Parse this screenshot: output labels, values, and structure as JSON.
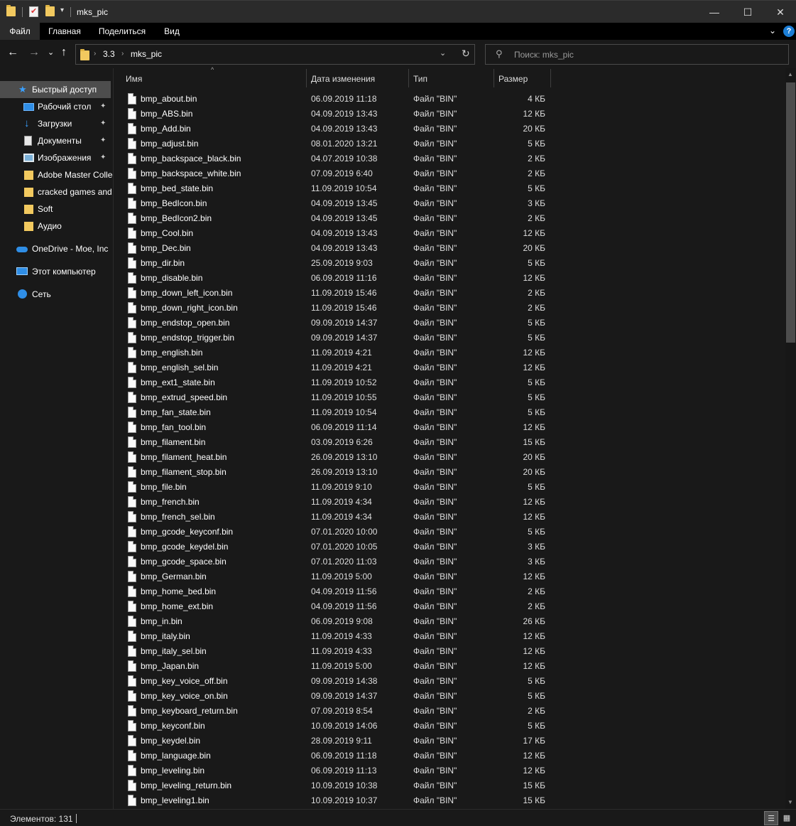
{
  "window": {
    "title": "mks_pic",
    "minimize_glyph": "—",
    "maximize_glyph": "☐",
    "close_glyph": "✕"
  },
  "ribbon": {
    "tabs": [
      "Файл",
      "Главная",
      "Поделиться",
      "Вид"
    ],
    "active_tab": "Файл",
    "collapse_glyph": "⌄",
    "help_glyph": "?"
  },
  "address": {
    "crumbs": [
      "3.3",
      "mks_pic"
    ],
    "back_glyph": "←",
    "forward_glyph": "→",
    "recent_glyph": "⌄",
    "up_glyph": "↑",
    "dropdown_glyph": "⌄",
    "refresh_glyph": "↻"
  },
  "search": {
    "placeholder": "Поиск: mks_pic",
    "icon": "search-icon"
  },
  "nav": {
    "quick_access": "Быстрый доступ",
    "items": [
      {
        "label": "Рабочий стол",
        "icon": "desktop-icon",
        "pinned": true
      },
      {
        "label": "Загрузки",
        "icon": "downloads-icon",
        "pinned": true
      },
      {
        "label": "Документы",
        "icon": "documents-icon",
        "pinned": true
      },
      {
        "label": "Изображения",
        "icon": "pictures-icon",
        "pinned": true
      },
      {
        "label": "Adobe Master Collection",
        "icon": "folder-icon",
        "pinned": false
      },
      {
        "label": "cracked games and",
        "icon": "folder-icon",
        "pinned": false
      },
      {
        "label": "Soft",
        "icon": "folder-icon",
        "pinned": false
      },
      {
        "label": "Аудио",
        "icon": "folder-icon",
        "pinned": false
      }
    ],
    "onedrive": "OneDrive - Moe, Inc",
    "this_pc": "Этот компьютер",
    "network": "Сеть",
    "pin_glyph": "📌"
  },
  "columns": {
    "name": "Имя",
    "date": "Дата изменения",
    "type": "Тип",
    "size": "Размер",
    "sort_glyph": "^"
  },
  "files": [
    {
      "name": "bmp_about.bin",
      "date": "06.09.2019 11:18",
      "type": "Файл \"BIN\"",
      "size": "4 КБ"
    },
    {
      "name": "bmp_ABS.bin",
      "date": "04.09.2019 13:43",
      "type": "Файл \"BIN\"",
      "size": "12 КБ"
    },
    {
      "name": "bmp_Add.bin",
      "date": "04.09.2019 13:43",
      "type": "Файл \"BIN\"",
      "size": "20 КБ"
    },
    {
      "name": "bmp_adjust.bin",
      "date": "08.01.2020 13:21",
      "type": "Файл \"BIN\"",
      "size": "5 КБ"
    },
    {
      "name": "bmp_backspace_black.bin",
      "date": "04.07.2019 10:38",
      "type": "Файл \"BIN\"",
      "size": "2 КБ"
    },
    {
      "name": "bmp_backspace_white.bin",
      "date": "07.09.2019 6:40",
      "type": "Файл \"BIN\"",
      "size": "2 КБ"
    },
    {
      "name": "bmp_bed_state.bin",
      "date": "11.09.2019 10:54",
      "type": "Файл \"BIN\"",
      "size": "5 КБ"
    },
    {
      "name": "bmp_BedIcon.bin",
      "date": "04.09.2019 13:45",
      "type": "Файл \"BIN\"",
      "size": "3 КБ"
    },
    {
      "name": "bmp_BedIcon2.bin",
      "date": "04.09.2019 13:45",
      "type": "Файл \"BIN\"",
      "size": "2 КБ"
    },
    {
      "name": "bmp_Cool.bin",
      "date": "04.09.2019 13:43",
      "type": "Файл \"BIN\"",
      "size": "12 КБ"
    },
    {
      "name": "bmp_Dec.bin",
      "date": "04.09.2019 13:43",
      "type": "Файл \"BIN\"",
      "size": "20 КБ"
    },
    {
      "name": "bmp_dir.bin",
      "date": "25.09.2019 9:03",
      "type": "Файл \"BIN\"",
      "size": "5 КБ"
    },
    {
      "name": "bmp_disable.bin",
      "date": "06.09.2019 11:16",
      "type": "Файл \"BIN\"",
      "size": "12 КБ"
    },
    {
      "name": "bmp_down_left_icon.bin",
      "date": "11.09.2019 15:46",
      "type": "Файл \"BIN\"",
      "size": "2 КБ"
    },
    {
      "name": "bmp_down_right_icon.bin",
      "date": "11.09.2019 15:46",
      "type": "Файл \"BIN\"",
      "size": "2 КБ"
    },
    {
      "name": "bmp_endstop_open.bin",
      "date": "09.09.2019 14:37",
      "type": "Файл \"BIN\"",
      "size": "5 КБ"
    },
    {
      "name": "bmp_endstop_trigger.bin",
      "date": "09.09.2019 14:37",
      "type": "Файл \"BIN\"",
      "size": "5 КБ"
    },
    {
      "name": "bmp_english.bin",
      "date": "11.09.2019 4:21",
      "type": "Файл \"BIN\"",
      "size": "12 КБ"
    },
    {
      "name": "bmp_english_sel.bin",
      "date": "11.09.2019 4:21",
      "type": "Файл \"BIN\"",
      "size": "12 КБ"
    },
    {
      "name": "bmp_ext1_state.bin",
      "date": "11.09.2019 10:52",
      "type": "Файл \"BIN\"",
      "size": "5 КБ"
    },
    {
      "name": "bmp_extrud_speed.bin",
      "date": "11.09.2019 10:55",
      "type": "Файл \"BIN\"",
      "size": "5 КБ"
    },
    {
      "name": "bmp_fan_state.bin",
      "date": "11.09.2019 10:54",
      "type": "Файл \"BIN\"",
      "size": "5 КБ"
    },
    {
      "name": "bmp_fan_tool.bin",
      "date": "06.09.2019 11:14",
      "type": "Файл \"BIN\"",
      "size": "12 КБ"
    },
    {
      "name": "bmp_filament.bin",
      "date": "03.09.2019 6:26",
      "type": "Файл \"BIN\"",
      "size": "15 КБ"
    },
    {
      "name": "bmp_filament_heat.bin",
      "date": "26.09.2019 13:10",
      "type": "Файл \"BIN\"",
      "size": "20 КБ"
    },
    {
      "name": "bmp_filament_stop.bin",
      "date": "26.09.2019 13:10",
      "type": "Файл \"BIN\"",
      "size": "20 КБ"
    },
    {
      "name": "bmp_file.bin",
      "date": "11.09.2019 9:10",
      "type": "Файл \"BIN\"",
      "size": "5 КБ"
    },
    {
      "name": "bmp_french.bin",
      "date": "11.09.2019 4:34",
      "type": "Файл \"BIN\"",
      "size": "12 КБ"
    },
    {
      "name": "bmp_french_sel.bin",
      "date": "11.09.2019 4:34",
      "type": "Файл \"BIN\"",
      "size": "12 КБ"
    },
    {
      "name": "bmp_gcode_keyconf.bin",
      "date": "07.01.2020 10:00",
      "type": "Файл \"BIN\"",
      "size": "5 КБ"
    },
    {
      "name": "bmp_gcode_keydel.bin",
      "date": "07.01.2020 10:05",
      "type": "Файл \"BIN\"",
      "size": "3 КБ"
    },
    {
      "name": "bmp_gcode_space.bin",
      "date": "07.01.2020 11:03",
      "type": "Файл \"BIN\"",
      "size": "3 КБ"
    },
    {
      "name": "bmp_German.bin",
      "date": "11.09.2019 5:00",
      "type": "Файл \"BIN\"",
      "size": "12 КБ"
    },
    {
      "name": "bmp_home_bed.bin",
      "date": "04.09.2019 11:56",
      "type": "Файл \"BIN\"",
      "size": "2 КБ"
    },
    {
      "name": "bmp_home_ext.bin",
      "date": "04.09.2019 11:56",
      "type": "Файл \"BIN\"",
      "size": "2 КБ"
    },
    {
      "name": "bmp_in.bin",
      "date": "06.09.2019 9:08",
      "type": "Файл \"BIN\"",
      "size": "26 КБ"
    },
    {
      "name": "bmp_italy.bin",
      "date": "11.09.2019 4:33",
      "type": "Файл \"BIN\"",
      "size": "12 КБ"
    },
    {
      "name": "bmp_italy_sel.bin",
      "date": "11.09.2019 4:33",
      "type": "Файл \"BIN\"",
      "size": "12 КБ"
    },
    {
      "name": "bmp_Japan.bin",
      "date": "11.09.2019 5:00",
      "type": "Файл \"BIN\"",
      "size": "12 КБ"
    },
    {
      "name": "bmp_key_voice_off.bin",
      "date": "09.09.2019 14:38",
      "type": "Файл \"BIN\"",
      "size": "5 КБ"
    },
    {
      "name": "bmp_key_voice_on.bin",
      "date": "09.09.2019 14:37",
      "type": "Файл \"BIN\"",
      "size": "5 КБ"
    },
    {
      "name": "bmp_keyboard_return.bin",
      "date": "07.09.2019 8:54",
      "type": "Файл \"BIN\"",
      "size": "2 КБ"
    },
    {
      "name": "bmp_keyconf.bin",
      "date": "10.09.2019 14:06",
      "type": "Файл \"BIN\"",
      "size": "5 КБ"
    },
    {
      "name": "bmp_keydel.bin",
      "date": "28.09.2019 9:11",
      "type": "Файл \"BIN\"",
      "size": "17 КБ"
    },
    {
      "name": "bmp_language.bin",
      "date": "06.09.2019 11:18",
      "type": "Файл \"BIN\"",
      "size": "12 КБ"
    },
    {
      "name": "bmp_leveling.bin",
      "date": "06.09.2019 11:13",
      "type": "Файл \"BIN\"",
      "size": "12 КБ"
    },
    {
      "name": "bmp_leveling_return.bin",
      "date": "10.09.2019 10:38",
      "type": "Файл \"BIN\"",
      "size": "15 КБ"
    },
    {
      "name": "bmp_leveling1.bin",
      "date": "10.09.2019 10:37",
      "type": "Файл \"BIN\"",
      "size": "15 КБ"
    }
  ],
  "status": {
    "items_text": "Элементов: 131",
    "details_view_glyph": "☰",
    "tiles_view_glyph": "▦"
  }
}
